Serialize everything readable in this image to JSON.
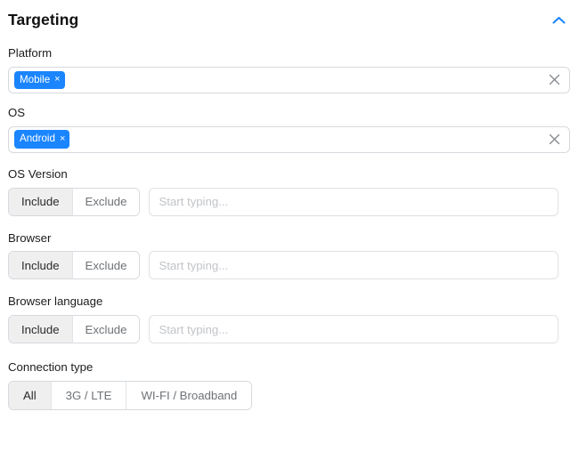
{
  "header": {
    "title": "Targeting",
    "collapse_icon": "chevron-up-icon",
    "accent_color": "#1a85ff"
  },
  "fields": {
    "platform": {
      "label": "Platform",
      "chips": [
        {
          "label": "Mobile",
          "remove_icon": "×"
        }
      ],
      "clear_icon": "×"
    },
    "os": {
      "label": "OS",
      "chips": [
        {
          "label": "Android",
          "remove_icon": "×"
        }
      ],
      "clear_icon": "×"
    },
    "os_version": {
      "label": "OS Version",
      "options": [
        "Include",
        "Exclude"
      ],
      "selected": "Include",
      "input_value": "",
      "placeholder": "Start typing..."
    },
    "browser": {
      "label": "Browser",
      "options": [
        "Include",
        "Exclude"
      ],
      "selected": "Include",
      "input_value": "",
      "placeholder": "Start typing..."
    },
    "browser_language": {
      "label": "Browser language",
      "options": [
        "Include",
        "Exclude"
      ],
      "selected": "Include",
      "input_value": "",
      "placeholder": "Start typing..."
    },
    "connection_type": {
      "label": "Connection type",
      "options": [
        "All",
        "3G / LTE",
        "WI-FI / Broadband"
      ],
      "selected": "All"
    }
  },
  "colors": {
    "chip_bg": "#1a85ff",
    "chip_text": "#ffffff",
    "selected_segment_bg": "#efefef",
    "border": "#d6d9de",
    "placeholder": "#c2c4c8"
  }
}
